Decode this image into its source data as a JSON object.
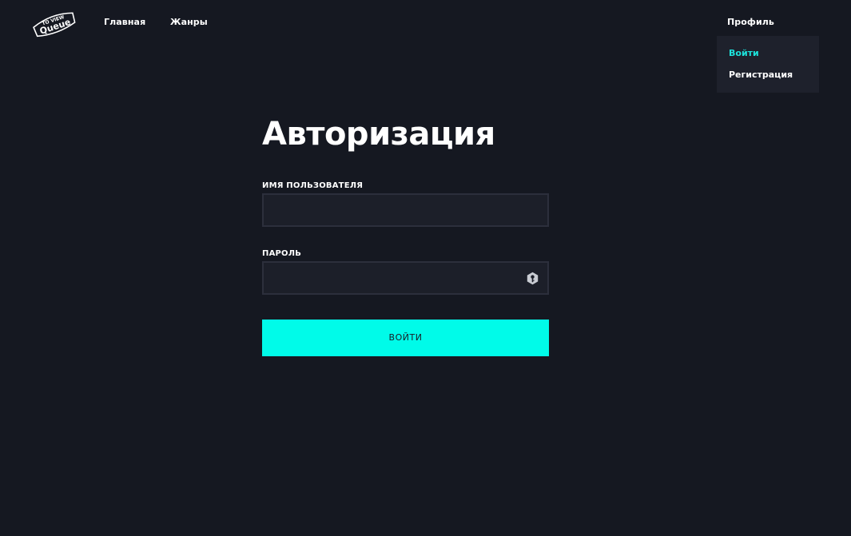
{
  "header": {
    "logo": {
      "line1": "TO VIEW",
      "line2": "Queue",
      "icon": "logo-icon"
    },
    "nav": {
      "home_label": "Главная",
      "genres_label": "Жанры",
      "profile_label": "Профиль"
    },
    "profile_menu": {
      "items": [
        {
          "label": "Войти",
          "active": true
        },
        {
          "label": "Регистрация",
          "active": false
        }
      ]
    }
  },
  "form": {
    "title": "Авторизация",
    "username_label": "ИМЯ ПОЛЬЗОВАТЕЛЯ",
    "username_value": "",
    "password_label": "ПАРОЛЬ",
    "password_value": "",
    "password_icon": "key-icon",
    "submit_label": "ВОЙТИ"
  },
  "colors": {
    "background": "#151821",
    "accent": "#00fbe9",
    "active_link": "#1de3dc",
    "dropdown_bg": "#1e212c",
    "input_bg": "#1c1f29",
    "input_border": "#2c2f3c"
  }
}
